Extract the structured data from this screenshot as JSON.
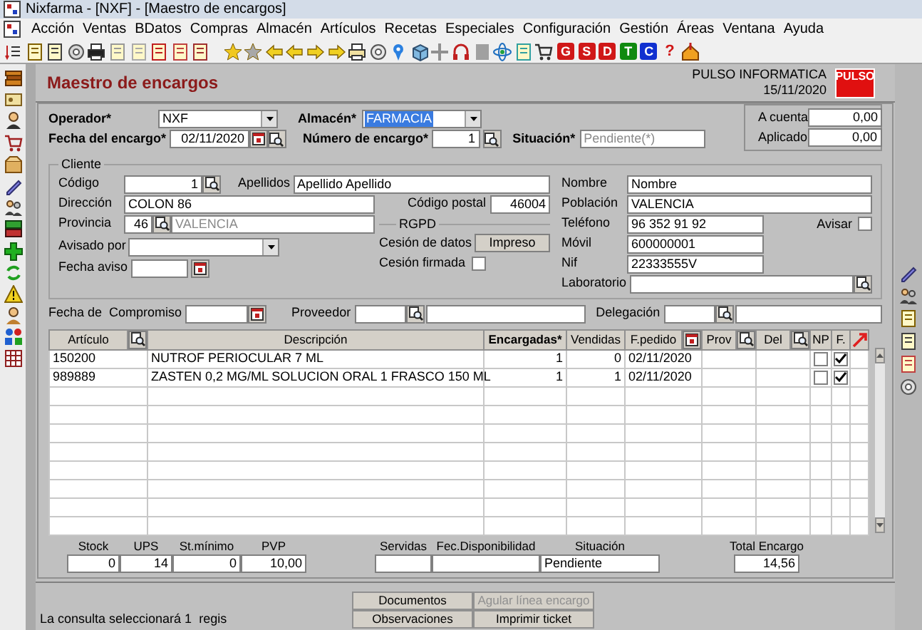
{
  "window": {
    "title": "Nixfarma - [NXF] - [Maestro de encargos]"
  },
  "menu": [
    "Acción",
    "Ventas",
    "BDatos",
    "Compras",
    "Almacén",
    "Artículos",
    "Recetas",
    "Especiales",
    "Configuración",
    "Gestión",
    "Áreas",
    "Ventana",
    "Ayuda"
  ],
  "toolbar_letters": [
    {
      "label": "G",
      "kind": "box",
      "color": "#d01818"
    },
    {
      "label": "S",
      "kind": "box",
      "color": "#d01818"
    },
    {
      "label": "D",
      "kind": "box",
      "color": "#d01818"
    },
    {
      "label": "T",
      "kind": "box",
      "color": "#108a10"
    },
    {
      "label": "C",
      "kind": "box",
      "color": "#1030d0"
    },
    {
      "label": "?",
      "kind": "glyph",
      "color": "#d01818"
    }
  ],
  "form": {
    "title": "Maestro de encargos",
    "company": "PULSO INFORMATICA",
    "date": "15/11/2020",
    "logo": "PULSO"
  },
  "header": {
    "operador": {
      "label": "Operador*",
      "value": "NXF"
    },
    "almacen": {
      "label": "Almacén*",
      "value": "FARMACIA",
      "selected": true
    },
    "fecha": {
      "label": "Fecha del encargo*",
      "value": "02/11/2020"
    },
    "numero": {
      "label": "Número de encargo*",
      "value": "1"
    },
    "situacion": {
      "label": "Situación*",
      "value": "Pendiente(*)",
      "disabled": true
    }
  },
  "account": [
    {
      "label": "A cuenta",
      "value": "0,00"
    },
    {
      "label": "Aplicado",
      "value": "0,00"
    }
  ],
  "cliente": {
    "title": "Cliente",
    "codigo": {
      "label": "Código",
      "value": "1"
    },
    "apellidos": {
      "label": "Apellidos",
      "value": "Apellido Apellido"
    },
    "direccion": {
      "label": "Dirección",
      "value": "COLON 86"
    },
    "codigo_postal": {
      "label": "Código postal",
      "value": "46004"
    },
    "provincia": {
      "label": "Provincia",
      "code": "46",
      "value": "VALENCIA",
      "disabled": true
    },
    "avisado_por": {
      "label": "Avisado por"
    },
    "fecha_aviso": {
      "label": "Fecha aviso"
    },
    "rgpd": {
      "title": "RGPD",
      "cesion_datos": {
        "label": "Cesión de datos",
        "button": "Impreso"
      },
      "cesion_firmada": {
        "label": "Cesión firmada",
        "checked": false
      }
    },
    "nombre": {
      "label": "Nombre",
      "value": "Nombre"
    },
    "poblacion": {
      "label": "Población",
      "value": "VALENCIA"
    },
    "telefono": {
      "label": "Teléfono",
      "value": "96 352 91 92"
    },
    "avisar": {
      "label": "Avisar",
      "checked": false
    },
    "movil": {
      "label": "Móvil",
      "value": "600000001"
    },
    "nif": {
      "label": "Nif",
      "value": "22333555V"
    },
    "laboratorio": {
      "label": "Laboratorio"
    }
  },
  "filters": [
    {
      "label": "Fecha de  Compromiso",
      "kind": "date"
    },
    {
      "label": "Proveedor",
      "kind": "lookup"
    },
    {
      "label": "Delegación",
      "kind": "lookup"
    }
  ],
  "table": {
    "columns": [
      {
        "label": "Artículo",
        "bold": false,
        "kind": "lookup"
      },
      {
        "label": "Descripción",
        "bold": false,
        "kind": "text"
      },
      {
        "label": "Encargadas*",
        "bold": true,
        "kind": "text"
      },
      {
        "label": "Vendidas",
        "bold": false,
        "kind": "text"
      },
      {
        "label": "F.pedido",
        "bold": false,
        "kind": "date"
      },
      {
        "label": "Prov",
        "bold": false,
        "kind": "lookup"
      },
      {
        "label": "Del",
        "bold": false,
        "kind": "lookup"
      },
      {
        "label": "NP",
        "bold": false,
        "kind": "text"
      },
      {
        "label": "F.",
        "bold": false,
        "kind": "text"
      }
    ],
    "rows": [
      {
        "articulo": "150200",
        "descripcion": "NUTROF PERIOCULAR 7 ML",
        "encargadas": "1",
        "vendidas": "0",
        "f_pedido": "02/11/2020",
        "np": false,
        "f": true
      },
      {
        "articulo": "989889",
        "descripcion": "ZASTEN 0,2 MG/ML SOLUCION ORAL 1 FRASCO 150 ML",
        "encargadas": "1",
        "vendidas": "1",
        "f_pedido": "02/11/2020",
        "np": false,
        "f": true
      }
    ]
  },
  "totals": [
    {
      "label": "Stock",
      "value": "0"
    },
    {
      "label": "UPS",
      "value": "14"
    },
    {
      "label": "St.mínimo",
      "value": "0"
    },
    {
      "label": "PVP",
      "value": "10,00"
    }
  ],
  "status_fields": [
    {
      "label": "Servidas"
    },
    {
      "label": "Fec.Disponibilidad"
    },
    {
      "label": "Situación",
      "value": "Pendiente"
    }
  ],
  "total": {
    "label": "Total Encargo",
    "value": "14,56"
  },
  "buttons": [
    {
      "label": "Documentos",
      "disabled": false
    },
    {
      "label": "Agular línea encargo",
      "disabled": true
    },
    {
      "label": "Observaciones",
      "disabled": false
    },
    {
      "label": "Imprimir ticket",
      "disabled": false
    }
  ],
  "status_bar": "La consulta seleccionará 1  regis"
}
